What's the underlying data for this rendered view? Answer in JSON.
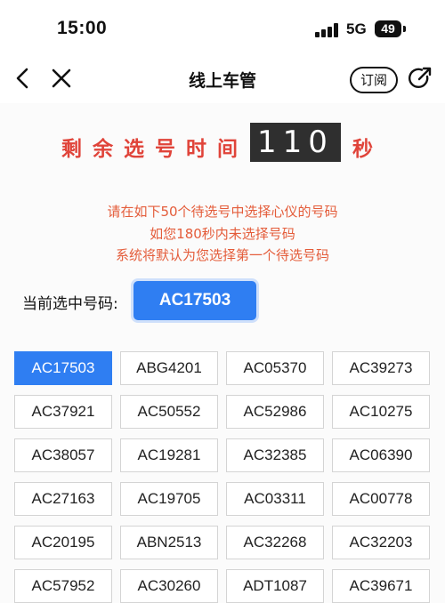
{
  "status_bar": {
    "time": "15:00",
    "network": "5G",
    "battery": "49"
  },
  "nav": {
    "title": "线上车管",
    "subscribe_label": "订阅"
  },
  "countdown": {
    "label": "剩余选号时间",
    "seconds": "110",
    "unit": "秒"
  },
  "notice": [
    "请在如下50个待选号中选择心仪的号码",
    "如您180秒内未选择号码",
    "系统将默认为您选择第一个待选号码"
  ],
  "current": {
    "label": "当前选中号码:",
    "plate": "AC17503"
  },
  "plates": [
    "AC17503",
    "ABG4201",
    "AC05370",
    "AC39273",
    "AC37921",
    "AC50552",
    "AC52986",
    "AC10275",
    "AC38057",
    "AC19281",
    "AC32385",
    "AC06390",
    "AC27163",
    "AC19705",
    "AC03311",
    "AC00778",
    "AC20195",
    "ABN2513",
    "AC32268",
    "AC32203",
    "AC57952",
    "AC30260",
    "ADT1087",
    "AC39671"
  ],
  "selected_index": 0,
  "colors": {
    "accent": "#2f7ef2",
    "warning": "#e0443a"
  }
}
